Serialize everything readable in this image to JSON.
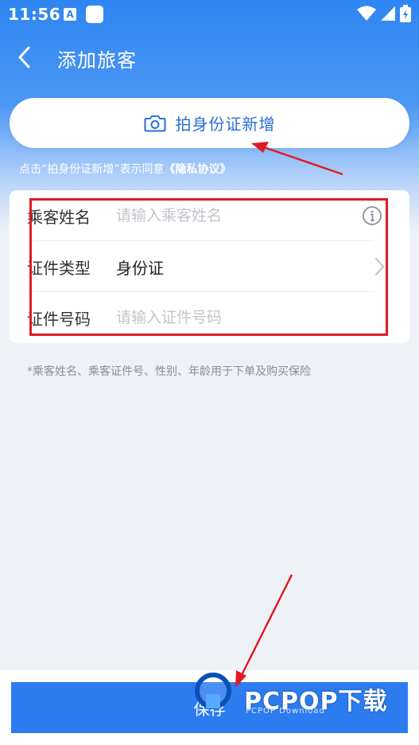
{
  "status_bar": {
    "time": "11:56",
    "notification_letter": "A"
  },
  "navbar": {
    "title": "添加旅客"
  },
  "scan_button": {
    "label": "拍身份证新增"
  },
  "consent": {
    "text": "点击“拍身份证新增”表示同意",
    "link": "《隐私协议》"
  },
  "form": {
    "name_row": {
      "label": "乘客姓名",
      "placeholder": "请输入乘客姓名"
    },
    "id_type_row": {
      "label": "证件类型",
      "value": "身份证"
    },
    "id_number_row": {
      "label": "证件号码",
      "placeholder": "请输入证件号码"
    }
  },
  "note": "*乘客姓名、乘客证件号、性别、年龄用于下单及购买保险",
  "save_button": {
    "label": "保存"
  },
  "watermark": {
    "brand": "PCPOP下载",
    "sub": "PCPOP Download"
  },
  "colors": {
    "primary": "#2c7cf0",
    "annotation_red": "#e01b24",
    "link_blue": "#2a6fd6"
  }
}
